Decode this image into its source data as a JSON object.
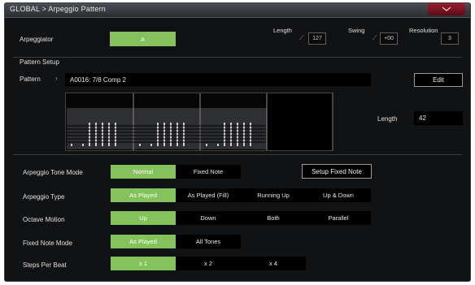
{
  "window": {
    "title": "GLOBAL > Arpeggio Pattern"
  },
  "arpeggiator": {
    "label": "Arpeggiator",
    "value": "A"
  },
  "length": {
    "label": "Length",
    "value": "127"
  },
  "swing": {
    "label": "Swing",
    "value": "+00"
  },
  "resolution": {
    "label": "Resolution",
    "value": "3"
  },
  "pattern_setup": {
    "heading": "Pattern Setup",
    "pattern_label": "Pattern",
    "pattern_value": "A0016: 7/8 Comp 2",
    "edit_label": "Edit",
    "length_label": "Length",
    "length_value": "42"
  },
  "tone_mode": {
    "label": "Arpeggio Tone Mode",
    "options": [
      "Normal",
      "Fixed Note"
    ],
    "selected": 0,
    "setup_button": "Setup Fixed Note"
  },
  "arp_type": {
    "label": "Arpeggio Type",
    "options": [
      "As Played",
      "As Played (Fill)",
      "Running Up",
      "Up & Down"
    ],
    "selected": 0
  },
  "octave_motion": {
    "label": "Octave Motion",
    "options": [
      "Up",
      "Down",
      "Both",
      "Parallel"
    ],
    "selected": 0
  },
  "fixed_note_mode": {
    "label": "Fixed Note Mode",
    "options": [
      "As Played",
      "All Tones"
    ],
    "selected": 0
  },
  "steps_per_beat": {
    "label": "Steps Per Beat",
    "options": [
      "x 1",
      "x 2",
      "x 4"
    ],
    "selected": 0
  },
  "colors": {
    "accent_green": "#84c25c",
    "title_menu_red": "#8c1a28",
    "panel_bg": "#111214"
  }
}
